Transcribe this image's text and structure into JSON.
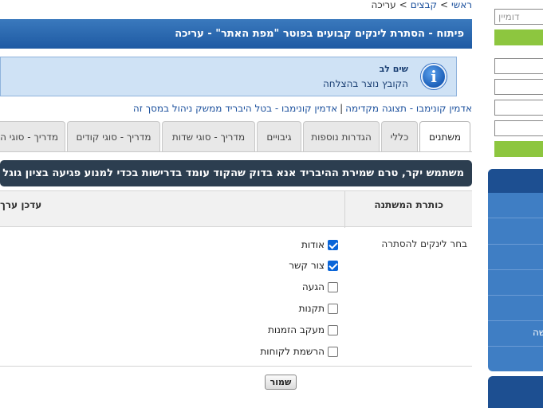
{
  "breadcrumb": {
    "home": "ראשי",
    "files": "קבצים",
    "current": "עריכה",
    "separator": ">"
  },
  "page_title": "פיתוח - הסתרת לינקים קבועים בפוטר \"מפת האתר\" - עריכה",
  "notice": {
    "icon_glyph": "i",
    "title": "שים לב",
    "message": "הקובץ נוצר בהצלחה"
  },
  "admin_links": {
    "link1": "אדמין קונימבו - תצוגה מקדימה",
    "link2": "אדמין קונימבו - בטל היבריד ממשק ניהול במסך זה",
    "separator": "|"
  },
  "tabs": [
    {
      "label": "משתנים",
      "active": true
    },
    {
      "label": "כללי",
      "active": false
    },
    {
      "label": "הגדרות נוספות",
      "active": false
    },
    {
      "label": "גיבויים",
      "active": false
    },
    {
      "label": "מדריך - סוגי שדות",
      "active": false
    },
    {
      "label": "מדריך - סוגי קודים",
      "active": false
    },
    {
      "label": "מדריך - סוגי ה",
      "active": false
    }
  ],
  "info_bar": "משתמש יקר, טרם שמירת ההיבריד אנא בדוק שהקוד עומד בדרישות בכדי למנוע פגיעה בציון גוגל וטעינ",
  "var_table": {
    "header_title": "כותרת המשתנה",
    "header_update": "עדכן ערך",
    "variable_label": "בחר לינקים להסתרה",
    "options": [
      {
        "label": "אודות",
        "checked": true
      },
      {
        "label": "צור קשר",
        "checked": true
      },
      {
        "label": "הגעה",
        "checked": false
      },
      {
        "label": "תקנות",
        "checked": false
      },
      {
        "label": "מעקב הזמנות",
        "checked": false
      },
      {
        "label": "הרשמת לקוחות",
        "checked": false
      }
    ]
  },
  "save_button": "שמור",
  "sidebar": {
    "search_placeholder": "דומיין",
    "nav_text": "שה"
  },
  "colors": {
    "title_bar": "#1e5aa3",
    "info_bar": "#2c3e50",
    "notice_bg": "#cfe2f5",
    "sidebar_green": "#8dc63f",
    "sidebar_nav": "#3f7ec4",
    "checkbox_checked": "#0a65d8"
  }
}
